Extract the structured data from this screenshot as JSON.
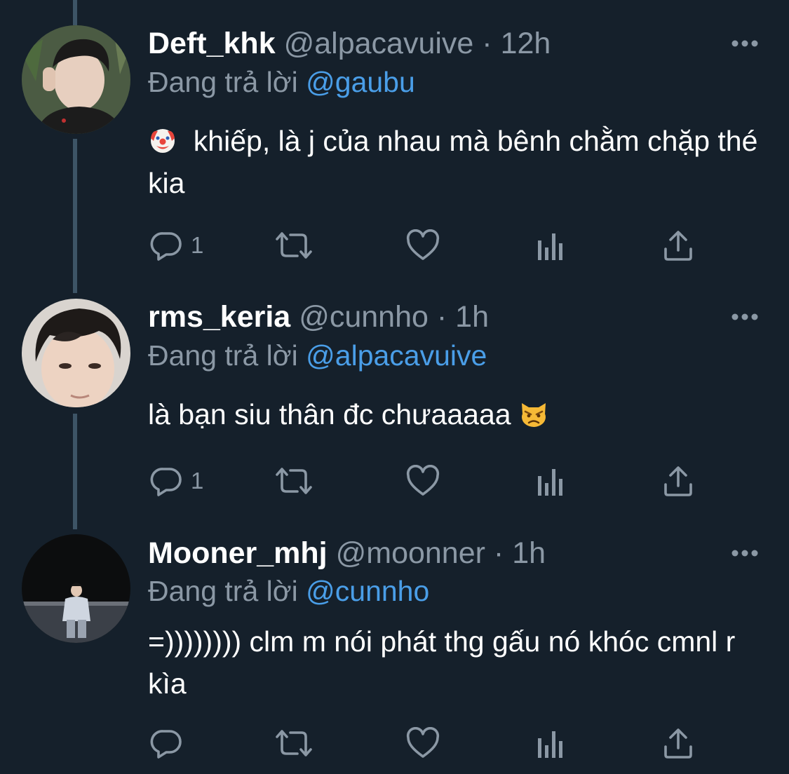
{
  "colors": {
    "background": "#15202b",
    "secondary_text": "#8b98a5",
    "mention": "#4a9ee8",
    "thread_line": "#3d5466"
  },
  "tweets": [
    {
      "name": "Deft_khk",
      "handle": "@alpacavuive",
      "separator": "·",
      "time": "12h",
      "reply_prefix": "Đang trả lời",
      "reply_to": "@gaubu",
      "emoji": "clown-face-emoji",
      "text": "khiếp, là j của nhau mà bênh chằm chặp thé kia",
      "reply_count": "1"
    },
    {
      "name": "rms_keria",
      "handle": "@cunnho",
      "separator": "·",
      "time": "1h",
      "reply_prefix": "Đang trả lời",
      "reply_to": "@alpacavuive",
      "text": "là bạn siu thân đc chưaaaaa",
      "emoji": "pouting-cat-emoji",
      "reply_count": "1"
    },
    {
      "name": "Mooner_mhj",
      "handle": "@moonner",
      "separator": "·",
      "time": "1h",
      "reply_prefix": "Đang trả lời",
      "reply_to": "@cunnho",
      "text": "=)))))))) clm m nói phát thg gấu nó khóc cmnl r kìa",
      "reply_count": ""
    }
  ]
}
